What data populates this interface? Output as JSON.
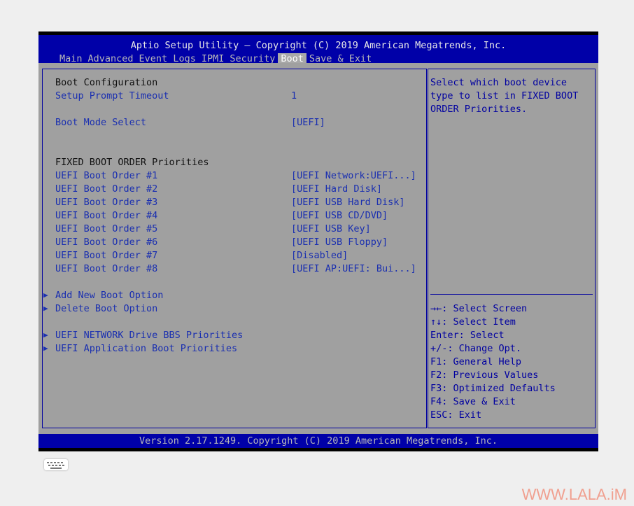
{
  "header": {
    "title": "Aptio Setup Utility – Copyright (C) 2019 American Megatrends, Inc.",
    "tabs": [
      "Main",
      "Advanced",
      "Event Logs",
      "IPMI",
      "Security",
      "Boot",
      "Save & Exit"
    ],
    "active_tab": "Boot"
  },
  "left": {
    "boot_configuration": "Boot Configuration",
    "setup_prompt_timeout": {
      "label": "Setup Prompt Timeout",
      "value": "1"
    },
    "boot_mode_select": {
      "label": "Boot Mode Select",
      "value": "[UEFI]"
    },
    "fixed_heading": "FIXED BOOT ORDER Priorities",
    "boot_orders": [
      {
        "label": "UEFI Boot Order #1",
        "value": "[UEFI Network:UEFI...]"
      },
      {
        "label": "UEFI Boot Order #2",
        "value": "[UEFI Hard Disk]"
      },
      {
        "label": "UEFI Boot Order #3",
        "value": "[UEFI USB Hard Disk]"
      },
      {
        "label": "UEFI Boot Order #4",
        "value": "[UEFI USB CD/DVD]"
      },
      {
        "label": "UEFI Boot Order #5",
        "value": "[UEFI USB Key]"
      },
      {
        "label": "UEFI Boot Order #6",
        "value": "[UEFI USB Floppy]"
      },
      {
        "label": "UEFI Boot Order #7",
        "value": "[Disabled]"
      },
      {
        "label": "UEFI Boot Order #8",
        "value": "[UEFI AP:UEFI: Bui...]"
      }
    ],
    "submenus": [
      "Add New Boot Option",
      "Delete Boot Option",
      "UEFI NETWORK Drive BBS Priorities",
      "UEFI Application Boot Priorities"
    ]
  },
  "right": {
    "help_lines": [
      "Select which boot device",
      "type to list in FIXED BOOT",
      "ORDER Priorities."
    ],
    "keys": [
      "→←: Select Screen",
      "↑↓: Select Item",
      "Enter: Select",
      "+/-: Change Opt.",
      "F1: General Help",
      "F2: Previous Values",
      "F3: Optimized Defaults",
      "F4: Save & Exit",
      "ESC: Exit"
    ]
  },
  "footer": "Version 2.17.1249. Copyright (C) 2019 American Megatrends, Inc.",
  "watermark": "WWW.LALA.iM"
}
